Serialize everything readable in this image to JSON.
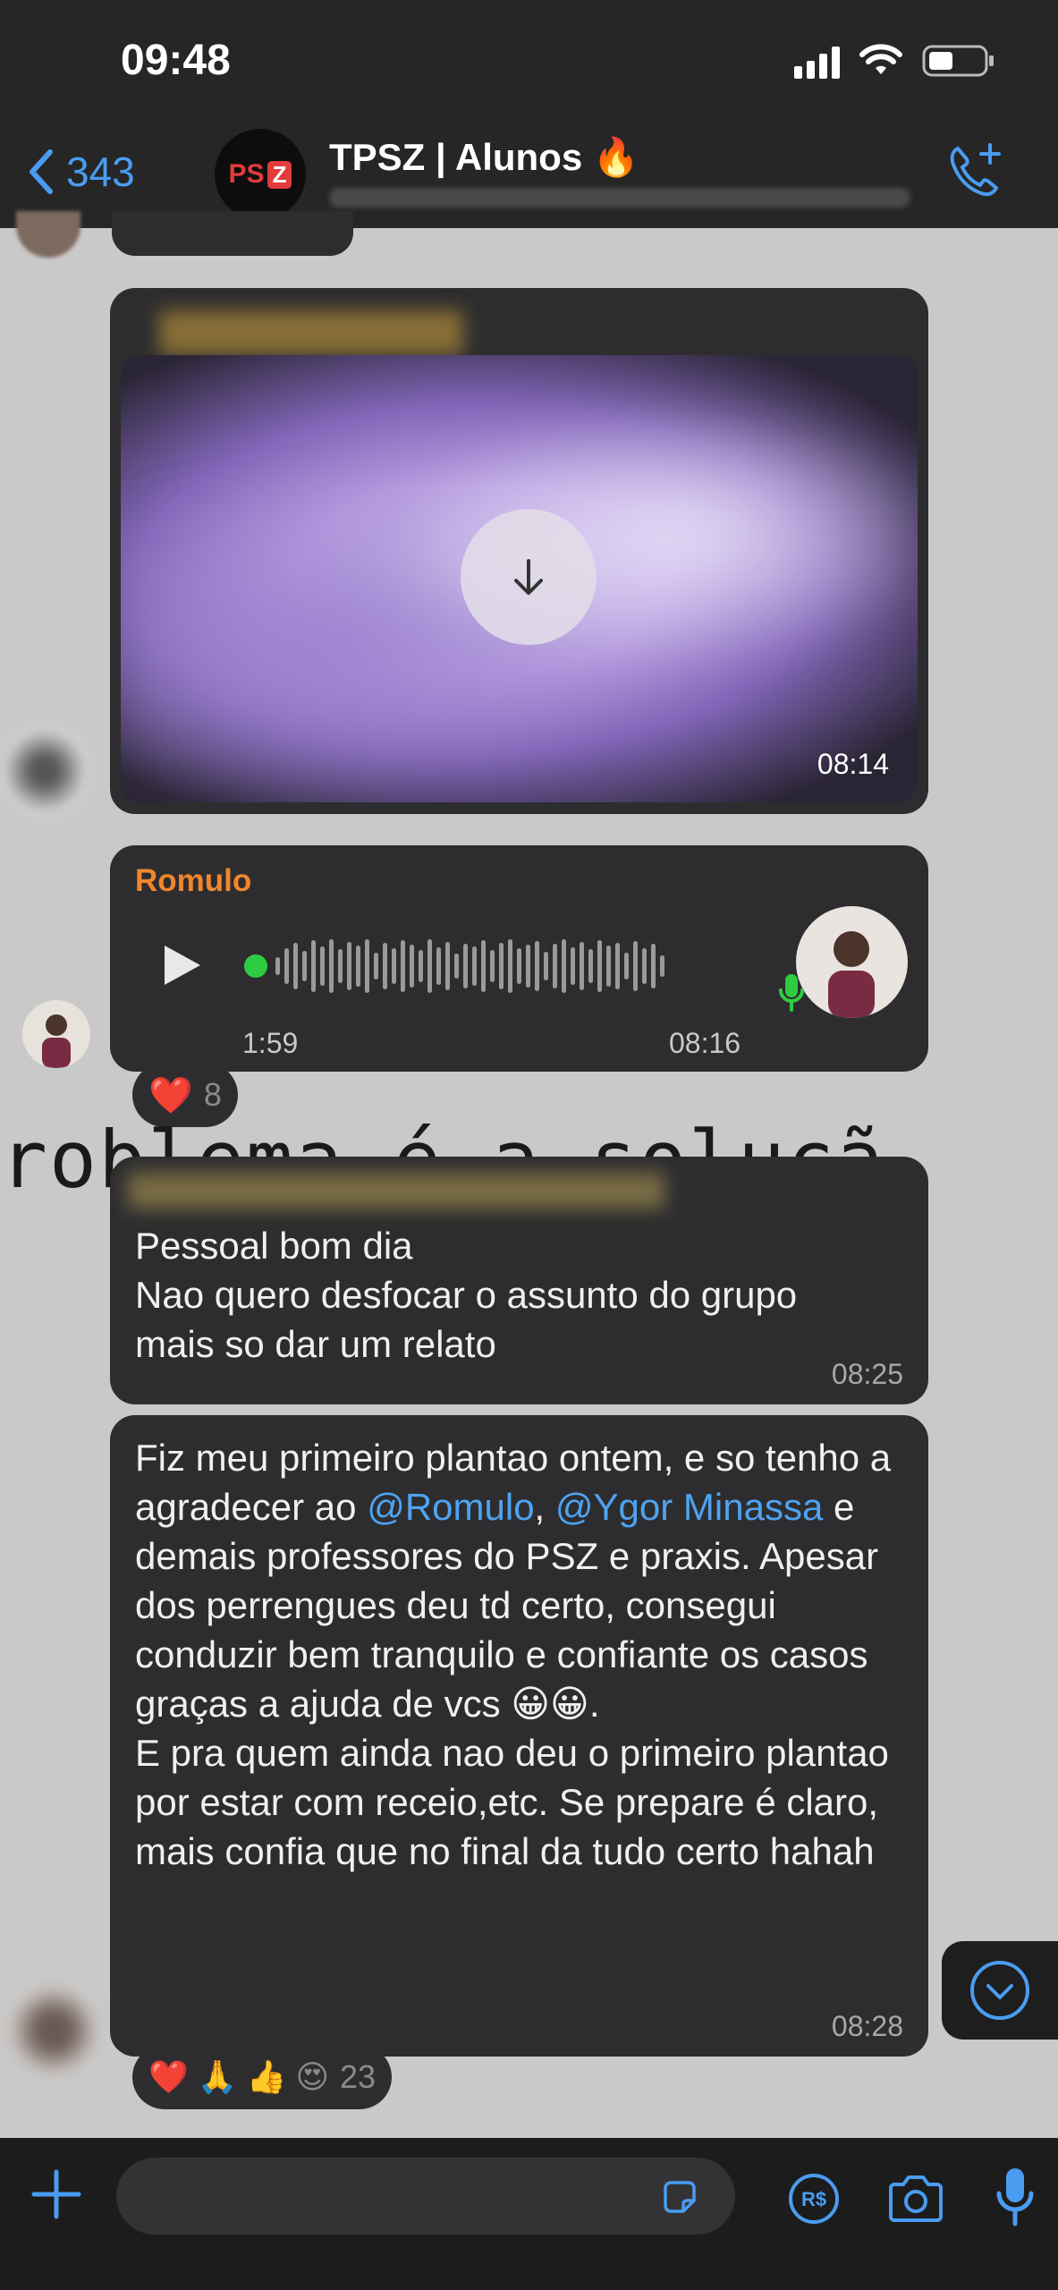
{
  "status_bar": {
    "time": "09:48"
  },
  "header": {
    "back_count": "343",
    "group_name": "TPSZ | Alunos 🔥",
    "avatar_text": "PS",
    "avatar_box": "Z"
  },
  "messages": {
    "video": {
      "time": "08:14"
    },
    "voice": {
      "sender": "Romulo",
      "duration": "1:59",
      "time": "08:16",
      "reaction_count": "8"
    },
    "text1": {
      "line1": "Pessoal bom dia",
      "line2": "Nao quero desfocar o assunto do grupo",
      "line3": "mais so dar um relato",
      "time": "08:25"
    },
    "text2": {
      "part1": "Fiz meu primeiro plantao ontem, e so tenho a agradecer ao ",
      "mention1": "@Romulo",
      "part2": ", ",
      "mention2": "@Ygor Minassa",
      "part3": " e demais professores do PSZ e praxis. Apesar dos perrengues deu td certo, consegui conduzir bem tranquilo e confiante os casos graças a ajuda de vcs 😀😀.",
      "part4": "E pra quem ainda nao deu o primeiro plantao por estar com receio,etc. Se prepare é claro, mais confia que no final da tudo certo hahah",
      "time": "08:28",
      "reactions": "❤️ 🙏 👍 😍",
      "reaction_count": "23"
    }
  },
  "background_text": "roblema é a soluçã",
  "colors": {
    "accent": "#4a9cf0",
    "sender": "#f0862c",
    "bubble": "#2d2d2f"
  },
  "icons": [
    "back-chevron-icon",
    "call-add-icon",
    "download-icon",
    "play-icon",
    "mic-icon",
    "heart-icon",
    "scroll-down-icon",
    "plus-icon",
    "sticker-icon",
    "pix-icon",
    "camera-icon"
  ]
}
